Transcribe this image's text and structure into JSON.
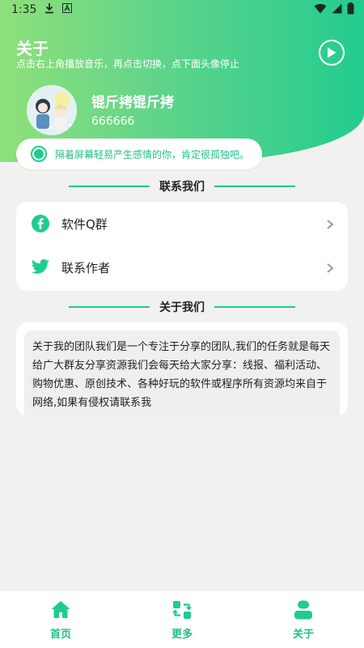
{
  "status": {
    "time": "1:35"
  },
  "header": {
    "title": "关于",
    "subtitle": "点击右上角播放音乐，再点击切换，点下面头像停止"
  },
  "profile": {
    "name": "锟斤拷锟斤拷",
    "id": "666666"
  },
  "quote": "隔着屏幕轻易产生感情的你，肯定很孤独吧。",
  "contact": {
    "title": "联系我们",
    "items": [
      {
        "label": "软件Q群",
        "icon": "facebook-icon"
      },
      {
        "label": "联系作者",
        "icon": "twitter-icon"
      }
    ]
  },
  "about": {
    "title": "关于我们",
    "text": "关于我的团队我们是一个专注于分享的团队,我们的任务就是每天给广大群友分享资源我们会每天给大家分享：线报、福利活动、购物优惠、原创技术、各种好玩的软件或程序所有资源均来自于网络,如果有侵权请联系我"
  },
  "nav": [
    {
      "label": "首页",
      "icon": "home-icon"
    },
    {
      "label": "更多",
      "icon": "grid-swap-icon"
    },
    {
      "label": "关于",
      "icon": "person-icon"
    }
  ],
  "colors": {
    "accent": "#1fcc8f",
    "header_start": "#8fe07a",
    "header_end": "#22cc8f",
    "background": "#f1f2ef"
  }
}
